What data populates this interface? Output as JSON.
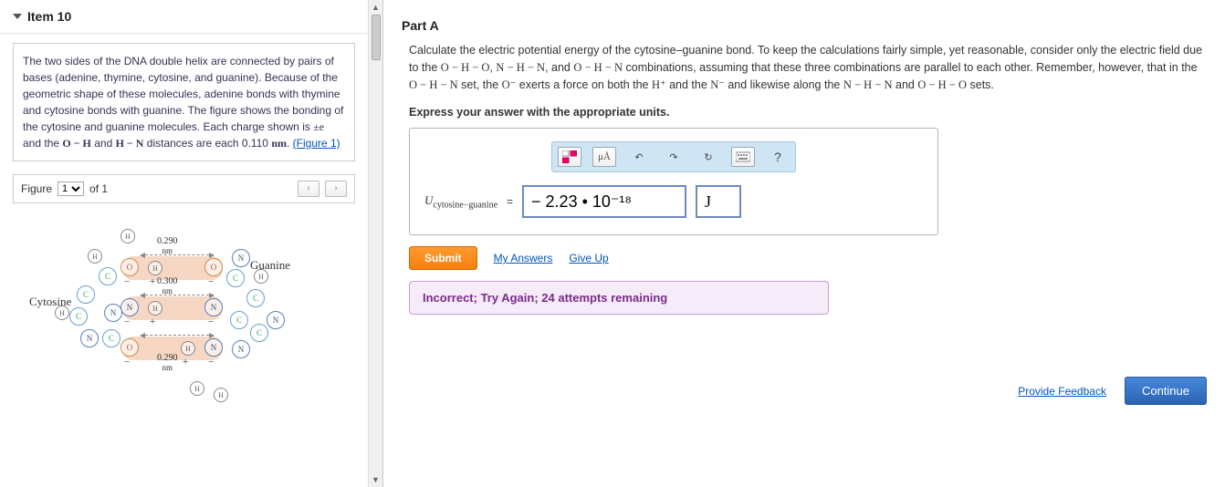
{
  "item": {
    "title": "Item 10"
  },
  "description": {
    "text_before_pm": "The two sides of the DNA double helix are connected by pairs of bases (adenine, thymine, cytosine, and guanine). Because of the geometric shape of these molecules, adenine bonds with thymine and cytosine bonds with guanine. The figure shows the bonding of the cytosine and guanine molecules. Each charge shown is ",
    "pm": "±e",
    "text_mid": " and the ",
    "oh": "O − H",
    "and": " and ",
    "hn": "H − N",
    "text_after": " distances are each 0.110 ",
    "nm": "nm",
    "period": ". ",
    "figure_link": "(Figure 1)"
  },
  "figure_bar": {
    "label": "Figure",
    "selected": "1",
    "of": "of 1"
  },
  "figure": {
    "cytosine": "Cytosine",
    "guanine": "Guanine",
    "d1": "0.290",
    "d2": "0.300",
    "d3": "0.290",
    "nm": "nm"
  },
  "part": {
    "title": "Part A"
  },
  "question": {
    "line1a": "Calculate the electric potential energy of the cytosine–guanine bond. To keep the calculations fairly simple, yet reasonable, consider only the electric field due to the ",
    "c1": "O − H − O",
    "comma1": ", ",
    "c2": "N − H − N",
    "comma2": ", and ",
    "c3": "O − H − N",
    "line1b": " combinations, assuming that these three combinations are parallel to each other. Remember, however, that in the ",
    "c4": "O − H − N",
    "mid2": " set, the ",
    "om": "O⁻",
    "mid3": " exerts a force on both the ",
    "hp": "H⁺",
    "mid4": " and the ",
    "nmn": "N⁻",
    "mid5": " and likewise along the ",
    "c5": "N − H − N",
    "mid6": " and ",
    "c6": "O − H − O",
    "mid7": " sets."
  },
  "express": "Express your answer with the appropriate units.",
  "toolbar": {
    "units": "μÅ",
    "help": "?"
  },
  "answer": {
    "lhs_var": "U",
    "lhs_sub": "cytosine−guanine",
    "equals": "=",
    "value": "− 2.23 • 10⁻¹⁸",
    "unit": "J"
  },
  "actions": {
    "submit": "Submit",
    "my_answers": "My Answers",
    "give_up": "Give Up"
  },
  "feedback": "Incorrect; Try Again; 24 attempts remaining",
  "footer": {
    "provide": "Provide Feedback",
    "continue": "Continue"
  }
}
